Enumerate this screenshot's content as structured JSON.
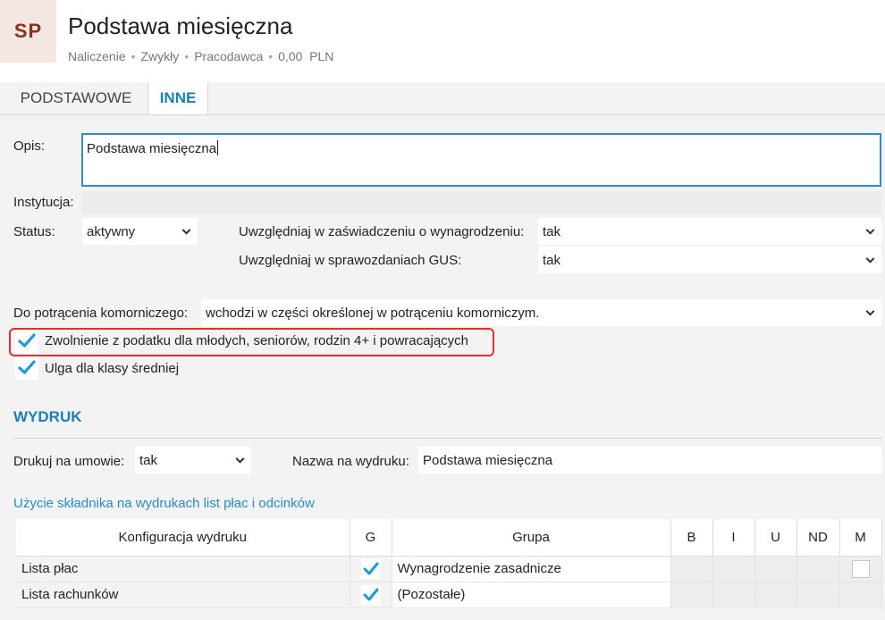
{
  "header": {
    "avatar": "SP",
    "title": "Podstawa miesięczna",
    "meta": [
      "Naliczenie",
      "Zwykły",
      "Pracodawca",
      "0,00  PLN"
    ]
  },
  "tabs": [
    {
      "label": "PODSTAWOWE",
      "active": false
    },
    {
      "label": "INNE",
      "active": true
    }
  ],
  "form": {
    "opis_label": "Opis:",
    "opis_value": "Podstawa miesięczna",
    "instytucja_label": "Instytucja:",
    "instytucja_value": "",
    "status_label": "Status:",
    "status_value": "aktywny",
    "zaswiadczenie_label": "Uwzględniaj w zaświadczeniu o wynagrodzeniu:",
    "zaswiadczenie_value": "tak",
    "gus_label": "Uwzględniaj w sprawozdaniach GUS:",
    "gus_value": "tak",
    "komornik_label": "Do potrącenia komorniczego:",
    "komornik_value": "wchodzi w części określonej w potrąceniu komorniczym.",
    "zwolnienie_label": "Zwolnienie z podatku dla młodych, seniorów, rodzin 4+ i powracających",
    "zwolnienie_checked": true,
    "ulga_label": "Ulga dla klasy średniej",
    "ulga_checked": true
  },
  "wydruk": {
    "section_title": "WYDRUK",
    "drukuj_label": "Drukuj na umowie:",
    "drukuj_value": "tak",
    "nazwa_label": "Nazwa na wydruku:",
    "nazwa_value": "Podstawa miesięczna",
    "usage_link": "Użycie składnika na wydrukach list płac i odcinków"
  },
  "table": {
    "headers": [
      "Konfiguracja wydruku",
      "G",
      "Grupa",
      "B",
      "I",
      "U",
      "ND",
      "M"
    ],
    "rows": [
      {
        "name": "Lista płac",
        "g": true,
        "grupa": "Wynagrodzenie zasadnicze",
        "m_box": true
      },
      {
        "name": "Lista rachunków",
        "g": true,
        "grupa": "(Pozostałe)",
        "m_box": false
      }
    ]
  },
  "colors": {
    "accent": "#1a7fb8",
    "check": "#1a9ad6",
    "highlight": "#e03030",
    "avatar_text": "#8a3222",
    "avatar_bg": "#f4e6e0"
  },
  "icons": {
    "check": "checkmark-icon",
    "dropdown": "chevron-down-icon"
  }
}
